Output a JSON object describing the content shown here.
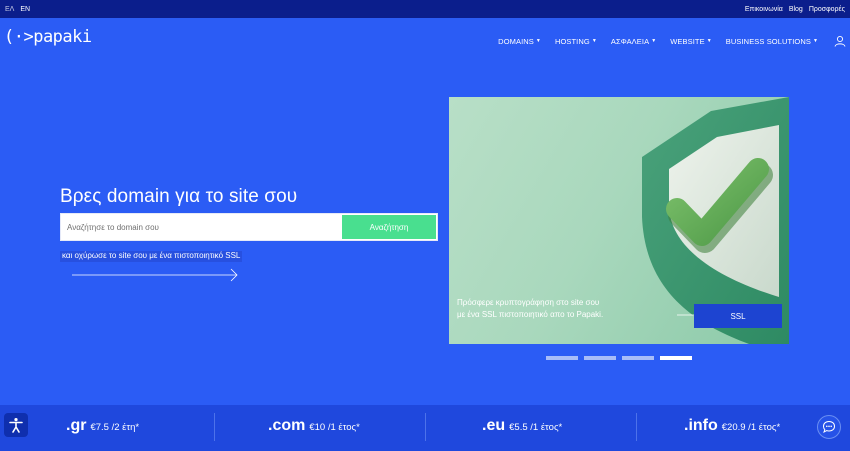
{
  "topbar": {
    "lang_el": "ΕΛ",
    "lang_en": "EN",
    "links": [
      "Επικοινωνία",
      "Blog",
      "Προσφορές"
    ]
  },
  "logo": {
    "text": "(·>papaki"
  },
  "nav": {
    "items": [
      "DOMAINS",
      "HOSTING",
      "ΑΣΦΑΛΕΙΑ",
      "WEBSITE",
      "BUSINESS SOLUTIONS"
    ],
    "user_icon": "user-icon"
  },
  "hero": {
    "title": "Βρες domain για το site σου",
    "search_placeholder": "Αναζήτησε το domain σου",
    "search_button": "Αναζήτηση",
    "ssl_link": "και οχύρωσε το site σου με ένα πιστοποιητικό SSL"
  },
  "promo": {
    "text": "Πρόσφερε κρυπτογράφηση στο site σου με ένα SSL πιστοποιητικό απο το Papaki.",
    "button": "SSL"
  },
  "carousel": {
    "count": 4,
    "active": 4
  },
  "tlds": [
    {
      "name": ".gr",
      "price": "€7.5 /2 έτη*"
    },
    {
      "name": ".com",
      "price": "€10 /1 έτος*"
    },
    {
      "name": ".eu",
      "price": "€5.5 /1 έτος*"
    },
    {
      "name": ".info",
      "price": "€20.9 /1 έτος*"
    }
  ],
  "colors": {
    "background": "#2b5cf5",
    "topbar": "#0b1e8c",
    "accent_green": "#49df8f",
    "bottombar": "#1f48dd"
  }
}
